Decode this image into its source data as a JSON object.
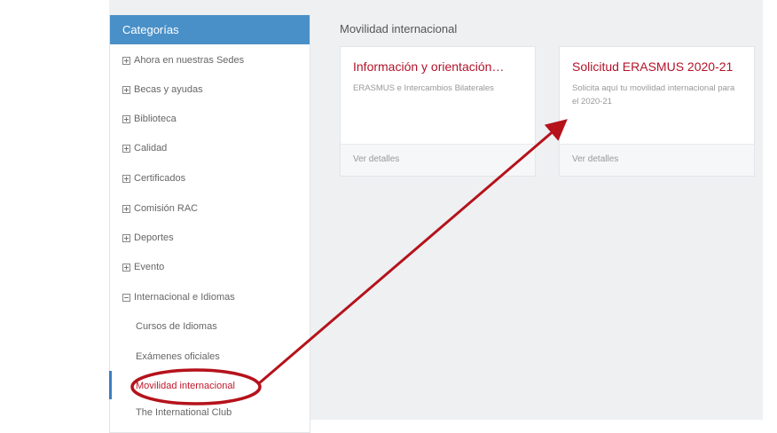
{
  "sidebar": {
    "header": "Categorías",
    "categories": [
      {
        "label": "Ahora en nuestras Sedes",
        "icon": "plus-box-icon"
      },
      {
        "label": "Becas y ayudas",
        "icon": "plus-box-icon"
      },
      {
        "label": "Biblioteca",
        "icon": "plus-box-icon"
      },
      {
        "label": "Calidad",
        "icon": "plus-box-icon"
      },
      {
        "label": "Certificados",
        "icon": "plus-box-icon"
      },
      {
        "label": "Comisión RAC",
        "icon": "plus-box-icon"
      },
      {
        "label": "Deportes",
        "icon": "plus-box-icon"
      },
      {
        "label": "Evento",
        "icon": "plus-box-icon"
      },
      {
        "label": "Internacional e Idiomas",
        "icon": "minus-box-icon"
      }
    ],
    "subitems": [
      {
        "label": "Cursos de Idiomas"
      },
      {
        "label": "Exámenes oficiales"
      },
      {
        "label": "Movilidad internacional"
      },
      {
        "label": "The International Club"
      }
    ]
  },
  "main": {
    "section_title": "Movilidad internacional",
    "cards": [
      {
        "title": "Información y orientación…",
        "description": "ERASMUS e Intercambios Bilaterales",
        "link": "Ver detalles"
      },
      {
        "title": "Solicitud ERASMUS 2020-21",
        "description": "Solicita aquí tu movilidad internacional para el 2020-21",
        "link": "Ver detalles"
      }
    ]
  },
  "colors": {
    "accent": "#4a90c8",
    "title_red": "#b3132a",
    "annotation_red": "#b5121b",
    "background": "#eef0f2"
  }
}
